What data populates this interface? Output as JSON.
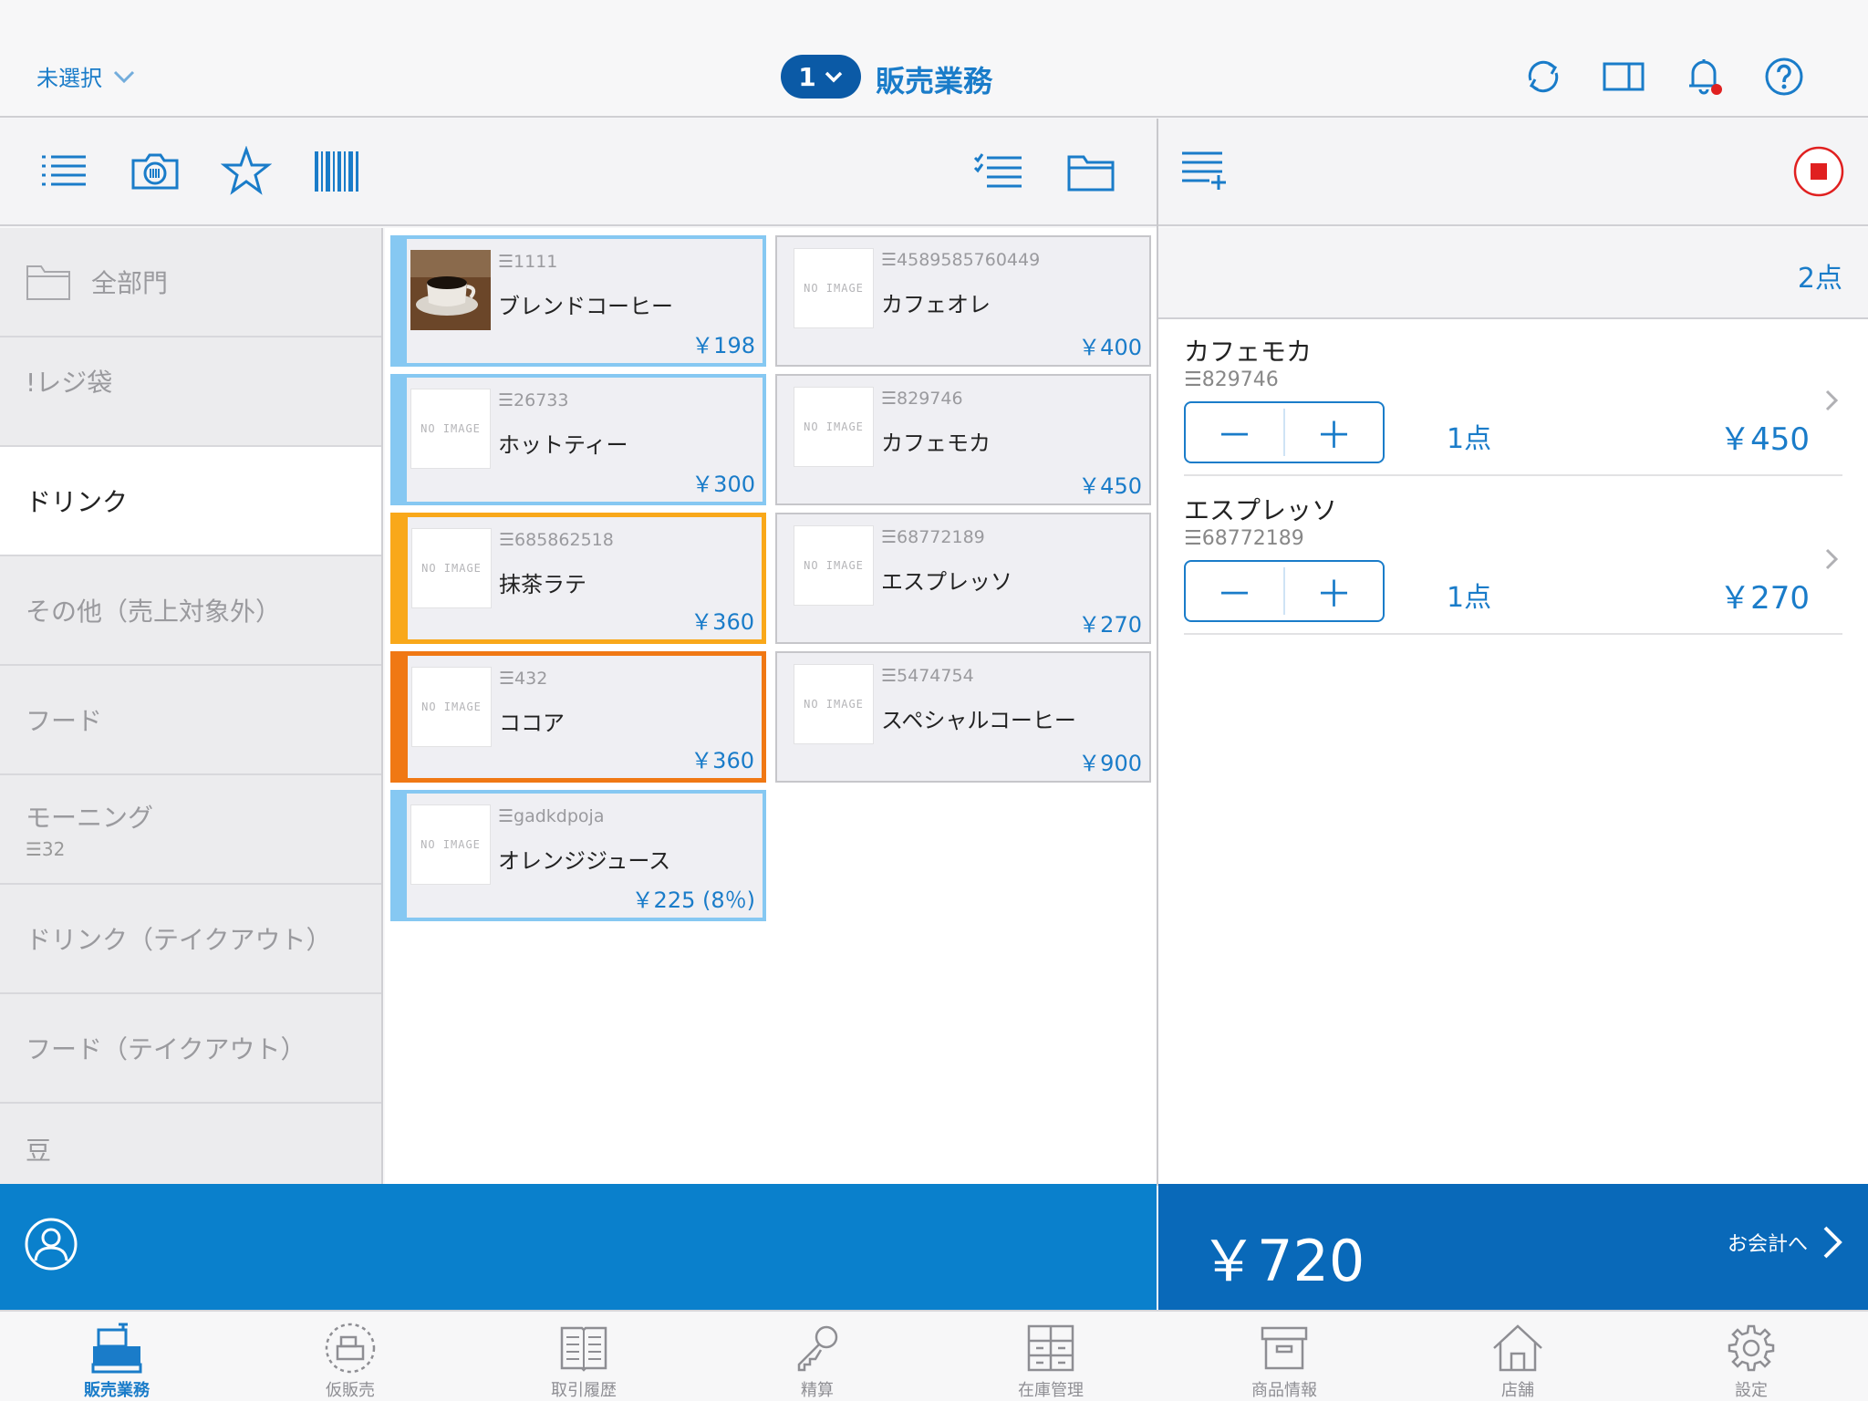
{
  "header": {
    "store": "未選択",
    "register_number": "1",
    "title": "販売業務"
  },
  "categories": [
    {
      "label": "全部門"
    },
    {
      "label": "!レジ袋"
    },
    {
      "label": "ドリンク",
      "active": true
    },
    {
      "label": "その他（売上対象外）"
    },
    {
      "label": "フード"
    },
    {
      "label": "モーニング",
      "sub": "☰32"
    },
    {
      "label": "ドリンク（テイクアウト）"
    },
    {
      "label": "フード（テイクアウト）"
    },
    {
      "label": "豆"
    }
  ],
  "products": [
    {
      "code": "☰1111",
      "name": "ブレンドコーヒー",
      "price": "￥198"
    },
    {
      "code": "☰4589585760449",
      "name": "カフェオレ",
      "price": "￥400",
      "image": "NO IMAGE"
    },
    {
      "code": "☰26733",
      "name": "ホットティー",
      "price": "￥300",
      "image": "NO IMAGE"
    },
    {
      "code": "☰829746",
      "name": "カフェモカ",
      "price": "￥450",
      "image": "NO IMAGE"
    },
    {
      "code": "☰685862518",
      "name": "抹茶ラテ",
      "price": "￥360",
      "image": "NO IMAGE"
    },
    {
      "code": "☰68772189",
      "name": "エスプレッソ",
      "price": "￥270",
      "image": "NO IMAGE"
    },
    {
      "code": "☰432",
      "name": "ココア",
      "price": "￥360",
      "image": "NO IMAGE"
    },
    {
      "code": "☰5474754",
      "name": "スペシャルコーヒー",
      "price": "￥900",
      "image": "NO IMAGE"
    },
    {
      "code": "☰gadkdpoja",
      "name": "オレンジジュース",
      "price": "￥225 (8％)",
      "image": "NO IMAGE"
    }
  ],
  "cart": {
    "count": "2点",
    "items": [
      {
        "name": "カフェモカ",
        "code": "☰829746",
        "qty": "1点",
        "price": "￥450",
        "minus": "－",
        "plus": "＋"
      },
      {
        "name": "エスプレッソ",
        "code": "☰68772189",
        "qty": "1点",
        "price": "￥270",
        "minus": "－",
        "plus": "＋"
      }
    ],
    "total": "￥720",
    "checkout_label": "お会計へ"
  },
  "tabs": [
    {
      "label": "販売業務",
      "icon": "register-icon",
      "active": true
    },
    {
      "label": "仮販売",
      "icon": "provisional-sale-icon"
    },
    {
      "label": "取引履歴",
      "icon": "history-book-icon"
    },
    {
      "label": "精算",
      "icon": "key-icon"
    },
    {
      "label": "在庫管理",
      "icon": "inventory-icon"
    },
    {
      "label": "商品情報",
      "icon": "box-icon"
    },
    {
      "label": "店舗",
      "icon": "store-icon"
    },
    {
      "label": "設定",
      "icon": "gear-icon"
    }
  ],
  "colors": {
    "accent": "#1a7cc9",
    "bottom_bar": "#0a80cc",
    "total_bar": "#0969b9",
    "selected_border": "#86c8f2",
    "orange_border": "#f9a81a",
    "dark_orange_border": "#f07814",
    "record_red": "#e02020"
  }
}
